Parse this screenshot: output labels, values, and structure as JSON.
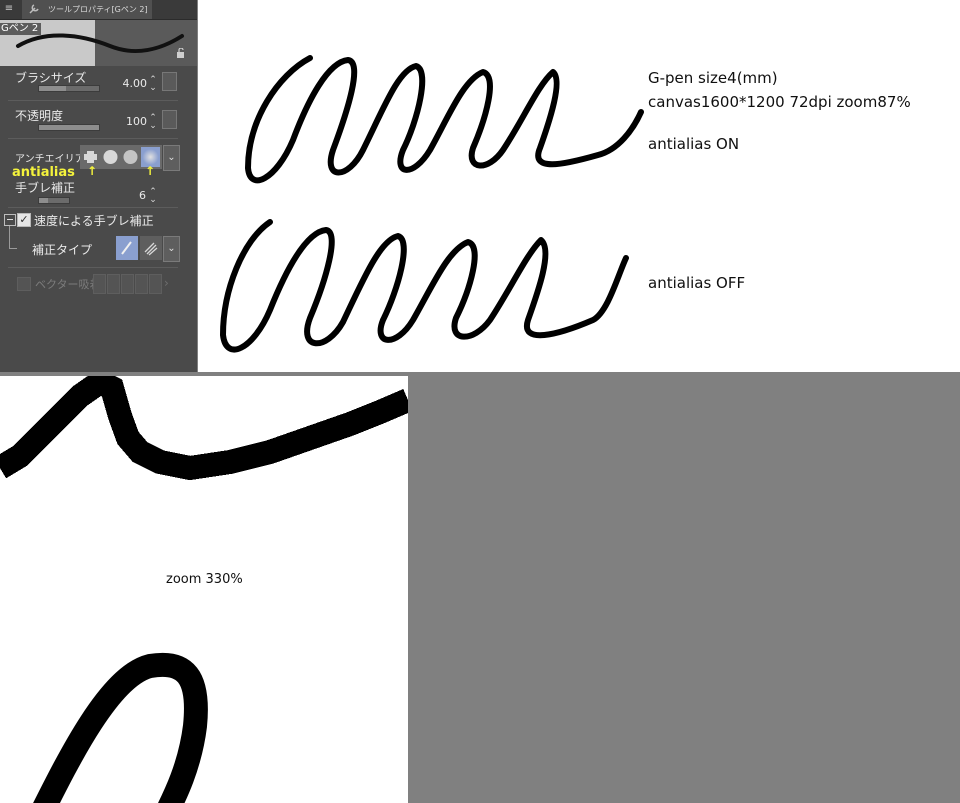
{
  "panel": {
    "tab_title": "ツールプロパティ[Gペン 2]",
    "brush_name": "Gペン 2",
    "brush_size": {
      "label": "ブラシサイズ",
      "value": "4.00",
      "level": 0.45
    },
    "opacity": {
      "label": "不透明度",
      "value": "100",
      "level": 1.0
    },
    "antialias": {
      "label": "アンチエイリアス",
      "annotation": "antialias",
      "selected_index": 3
    },
    "stabilization": {
      "label": "手ブレ補正",
      "value": "6",
      "level": 0.3
    },
    "speed_stabilization": {
      "label": "速度による手ブレ補正",
      "checked": true
    },
    "stabilization_type": {
      "label": "補正タイプ"
    },
    "vector_snap": {
      "label": "ベクター吸着"
    },
    "accent_color": "#8a9fcf",
    "annotation_color": "#f4f33c"
  },
  "canvas": {
    "line1": "G-pen   size4(mm)",
    "line2": "canvas1600*1200 72dpi zoom87%",
    "label_on": "antialias ON",
    "label_off": "antialias OFF"
  },
  "zoom": {
    "label": "zoom 330%"
  }
}
